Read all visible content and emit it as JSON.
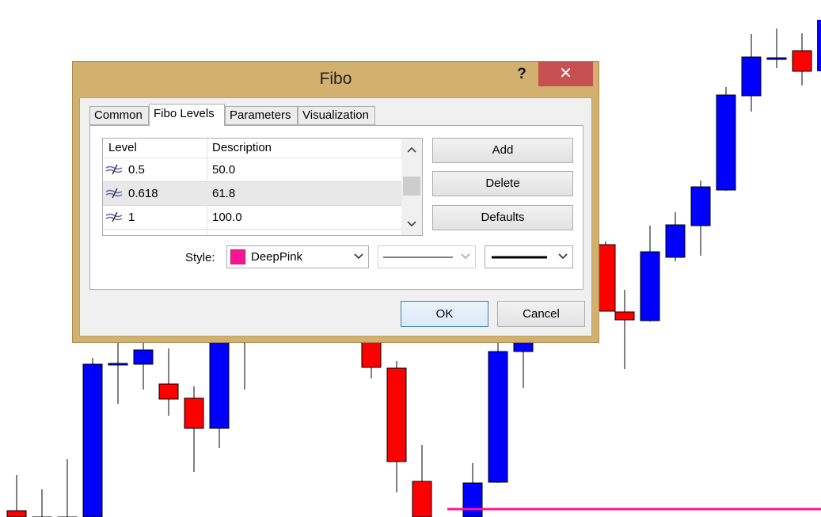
{
  "dialog": {
    "title": "Fibo",
    "help_label": "?",
    "close_label": "✕",
    "tabs": [
      {
        "label": "Common",
        "active": false
      },
      {
        "label": "Fibo Levels",
        "active": true
      },
      {
        "label": "Parameters",
        "active": false
      },
      {
        "label": "Visualization",
        "active": false
      }
    ],
    "levels_table": {
      "columns": [
        "Level",
        "Description"
      ],
      "rows": [
        {
          "level": "0.5",
          "description": "50.0",
          "selected": false
        },
        {
          "level": "0.618",
          "description": "61.8",
          "selected": true
        },
        {
          "level": "1",
          "description": "100.0",
          "selected": false
        }
      ]
    },
    "side_buttons": {
      "add": "Add",
      "delete": "Delete",
      "defaults": "Defaults"
    },
    "style": {
      "label": "Style:",
      "color_name": "DeepPink",
      "color_hex": "#ff1493",
      "line_style": "solid",
      "line_width": "thick"
    },
    "ok_label": "OK",
    "cancel_label": "Cancel"
  },
  "chart_colors": {
    "bull": "#0000ff",
    "bear": "#ff0000",
    "fibo_line": "#ff1493"
  }
}
